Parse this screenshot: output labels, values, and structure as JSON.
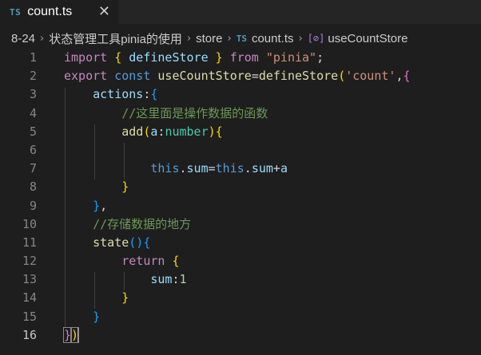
{
  "tab": {
    "badge": "TS",
    "title": "count.ts",
    "close": "✕"
  },
  "breadcrumb": {
    "items": [
      "8-24",
      "状态管理工具pinia的使用",
      "store"
    ],
    "file_badge": "TS",
    "file": "count.ts",
    "symbol_icon": "[⊘]",
    "symbol": "useCountStore"
  },
  "editor": {
    "line_numbers": [
      "1",
      "2",
      "3",
      "4",
      "5",
      "6",
      "7",
      "8",
      "9",
      "10",
      "11",
      "12",
      "13",
      "14",
      "15",
      "16"
    ],
    "active_line": "16",
    "lines": [
      [
        [
          "kw",
          "import "
        ],
        [
          "b1",
          "{ "
        ],
        [
          "pr",
          "defineStore "
        ],
        [
          "b1",
          "}"
        ],
        [
          "kw",
          " from "
        ],
        [
          "st",
          "\"pinia\""
        ],
        [
          "pn",
          ";"
        ]
      ],
      [
        [
          "kw",
          "export "
        ],
        [
          "dc",
          "const "
        ],
        [
          "fn",
          "useCountStore"
        ],
        [
          "pn",
          "="
        ],
        [
          "fn",
          "defineStore"
        ],
        [
          "b1",
          "("
        ],
        [
          "st",
          "'count'"
        ],
        [
          "pn",
          ","
        ],
        [
          "b2",
          "{"
        ]
      ],
      [
        [
          "pn",
          "    "
        ],
        [
          "pr",
          "actions"
        ],
        [
          "pn",
          ":"
        ],
        [
          "b3",
          "{"
        ]
      ],
      [
        [
          "pn",
          "        "
        ],
        [
          "cm",
          "//这里面是操作数据的函数"
        ]
      ],
      [
        [
          "pn",
          "        "
        ],
        [
          "fn",
          "add"
        ],
        [
          "b1",
          "("
        ],
        [
          "pr",
          "a"
        ],
        [
          "pn",
          ":"
        ],
        [
          "ty",
          "number"
        ],
        [
          "b1",
          ")"
        ],
        [
          "b1",
          "{"
        ]
      ],
      [],
      [
        [
          "pn",
          "            "
        ],
        [
          "dc",
          "this"
        ],
        [
          "pn",
          "."
        ],
        [
          "pr",
          "sum"
        ],
        [
          "pn",
          "="
        ],
        [
          "dc",
          "this"
        ],
        [
          "pn",
          "."
        ],
        [
          "pr",
          "sum"
        ],
        [
          "pn",
          "+"
        ],
        [
          "pr",
          "a"
        ]
      ],
      [
        [
          "pn",
          "        "
        ],
        [
          "b1",
          "}"
        ]
      ],
      [
        [
          "pn",
          "    "
        ],
        [
          "b3",
          "}"
        ],
        [
          "pn",
          ","
        ]
      ],
      [
        [
          "pn",
          "    "
        ],
        [
          "cm",
          "//存储数据的地方"
        ]
      ],
      [
        [
          "pn",
          "    "
        ],
        [
          "fn",
          "state"
        ],
        [
          "b3",
          "()"
        ],
        [
          "b3",
          "{"
        ]
      ],
      [
        [
          "pn",
          "        "
        ],
        [
          "kw",
          "return "
        ],
        [
          "b1",
          "{"
        ]
      ],
      [
        [
          "pn",
          "            "
        ],
        [
          "pr",
          "sum"
        ],
        [
          "pn",
          ":"
        ],
        [
          "nu",
          "1"
        ]
      ],
      [
        [
          "pn",
          "        "
        ],
        [
          "b1",
          "}"
        ]
      ],
      [
        [
          "pn",
          "    "
        ],
        [
          "b3",
          "}"
        ]
      ],
      [
        [
          "b2",
          "}"
        ],
        [
          "b1",
          ")"
        ]
      ]
    ]
  },
  "colors": {
    "background": "#1e1e1e",
    "keyword": "#c586c0",
    "declaration": "#569cd6",
    "function": "#dcdcaa",
    "property": "#9cdcfe",
    "string": "#ce9178",
    "comment": "#6a9955",
    "type": "#4ec9b0",
    "number": "#b5cea8"
  },
  "icons": {
    "tab_file": "typescript-file-icon",
    "close": "close-icon",
    "breadcrumb_sep": "chevron-right-icon",
    "symbol": "variable-symbol-icon"
  }
}
